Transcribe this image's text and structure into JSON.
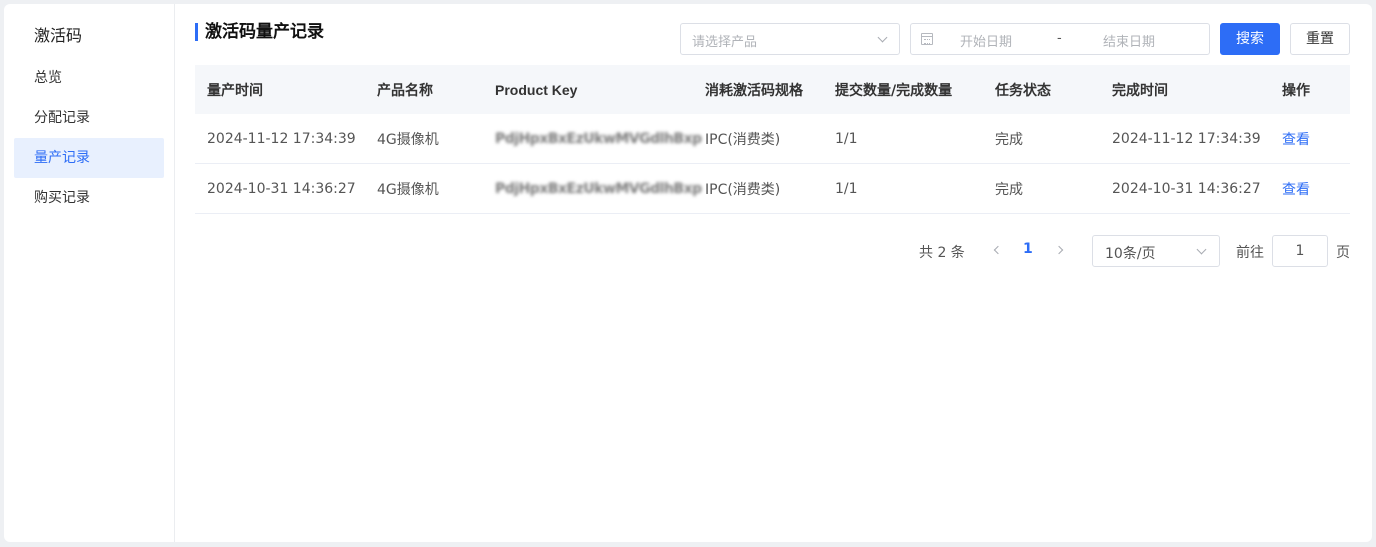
{
  "sidebar": {
    "title": "激活码",
    "items": [
      {
        "label": "总览",
        "active": false
      },
      {
        "label": "分配记录",
        "active": false
      },
      {
        "label": "量产记录",
        "active": true
      },
      {
        "label": "购买记录",
        "active": false
      }
    ]
  },
  "header": {
    "title": "激活码量产记录"
  },
  "filters": {
    "product_placeholder": "请选择产品",
    "start_date_placeholder": "开始日期",
    "date_separator": "-",
    "end_date_placeholder": "结束日期",
    "search_label": "搜索",
    "reset_label": "重置"
  },
  "table": {
    "columns": [
      "量产时间",
      "产品名称",
      "Product Key",
      "消耗激活码规格",
      "提交数量/完成数量",
      "任务状态",
      "完成时间",
      "操作"
    ],
    "rows": [
      {
        "time": "2024-11-12 17:34:39",
        "product": "4G摄像机",
        "key": "PdjHpxBxEzUkwMVGdlhBxp",
        "spec": "IPC(消费类)",
        "qty": "1/1",
        "status": "完成",
        "done_time": "2024-11-12 17:34:39",
        "action": "查看"
      },
      {
        "time": "2024-10-31 14:36:27",
        "product": "4G摄像机",
        "key": "PdjHpxBxEzUkwMVGdlhBxp",
        "spec": "IPC(消费类)",
        "qty": "1/1",
        "status": "完成",
        "done_time": "2024-10-31 14:36:27",
        "action": "查看"
      }
    ]
  },
  "pagination": {
    "total_text": "共 2 条",
    "current_page": "1",
    "page_size": "10条/页",
    "goto_label": "前往",
    "goto_value": "1",
    "page_unit": "页"
  },
  "colors": {
    "accent": "#2d6df6",
    "active_bg": "#e8f0fe",
    "header_bg": "#f5f7fa"
  }
}
